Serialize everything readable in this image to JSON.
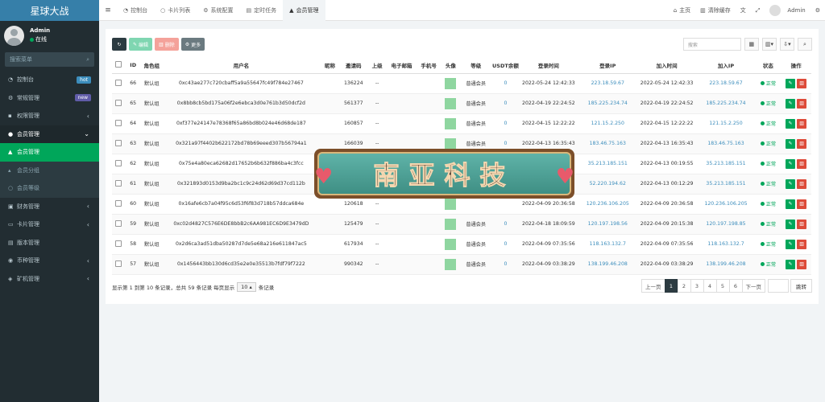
{
  "app": {
    "title": "星球大战"
  },
  "user": {
    "name": "Admin",
    "status": "在线"
  },
  "sidebar": {
    "search_placeholder": "搜索菜单",
    "items": [
      {
        "label": "控制台",
        "icon": "dashboard-icon",
        "badge": "hot",
        "badge_color": "#3c8dbc"
      },
      {
        "label": "常规管理",
        "icon": "cog-icon",
        "badge": "new",
        "badge_color": "#605ca8"
      },
      {
        "label": "权限管理",
        "icon": "group-icon"
      },
      {
        "label": "会员管理",
        "icon": "user-circle-icon"
      },
      {
        "label": "会员管理",
        "icon": "user-icon"
      },
      {
        "label": "会员分组",
        "icon": "users-icon"
      },
      {
        "label": "会员等级",
        "icon": "circle-icon"
      },
      {
        "label": "财务管理",
        "icon": "money-icon"
      },
      {
        "label": "卡片管理",
        "icon": "card-icon"
      },
      {
        "label": "版本管理",
        "icon": "book-icon"
      },
      {
        "label": "币种管理",
        "icon": "coin-icon"
      },
      {
        "label": "矿机管理",
        "icon": "server-icon"
      }
    ]
  },
  "topbar": {
    "tabs": [
      "控制台",
      "卡片列表",
      "系统配置",
      "定时任务",
      "会员管理"
    ],
    "home": "主页",
    "clear_cache": "清除缓存",
    "user": "Admin"
  },
  "toolbar": {
    "edit": "编辑",
    "delete": "删除",
    "more": "更多",
    "search_placeholder": "搜索"
  },
  "table": {
    "headers": [
      "ID",
      "角色组",
      "用户名",
      "昵称",
      "邀请码",
      "上级",
      "电子邮箱",
      "手机号",
      "头像",
      "等级",
      "USDT余额",
      "登录时间",
      "登录IP",
      "加入时间",
      "加入IP",
      "状态",
      "操作"
    ],
    "rows": [
      {
        "id": "66",
        "group": "默认组",
        "username": "0xc43ae277c720cbaff5a9a55647fc49f784e27467",
        "code": "136224",
        "parent": "--",
        "level": "普通会员",
        "usdt": "0",
        "login_time": "2022-05-24 12:42:33",
        "login_ip": "223.18.59.67",
        "join_time": "2022-05-24 12:42:33",
        "join_ip": "223.18.59.67",
        "status": "正常"
      },
      {
        "id": "65",
        "group": "默认组",
        "username": "0x8bb8cb5bd175a06f2e6ebca3d0e761b3d50dcf2d",
        "code": "561377",
        "parent": "--",
        "level": "普通会员",
        "usdt": "0",
        "login_time": "2022-04-19 22:24:52",
        "login_ip": "185.225.234.74",
        "join_time": "2022-04-19 22:24:52",
        "join_ip": "185.225.234.74",
        "status": "正常"
      },
      {
        "id": "64",
        "group": "默认组",
        "username": "0xf377e24147e78368f65a86bd8b024e46d68de187",
        "code": "160857",
        "parent": "--",
        "level": "普通会员",
        "usdt": "0",
        "login_time": "2022-04-15 12:22:22",
        "login_ip": "121.15.2.250",
        "join_time": "2022-04-15 12:22:22",
        "join_ip": "121.15.2.250",
        "status": "正常"
      },
      {
        "id": "63",
        "group": "默认组",
        "username": "0x321a97f4402b622172bd78b69eeed307b56794a1",
        "code": "166039",
        "parent": "--",
        "level": "普通会员",
        "usdt": "0",
        "login_time": "2022-04-13 16:35:43",
        "login_ip": "183.46.75.163",
        "join_time": "2022-04-13 16:35:43",
        "join_ip": "183.46.75.163",
        "status": "正常"
      },
      {
        "id": "62",
        "group": "默认组",
        "username": "0x75e4a80eca62682d17652b6b632f886ba4c3fcc",
        "code": "",
        "parent": "",
        "level": "",
        "usdt": "",
        "login_time": "4-13 00:19:55",
        "login_ip": "35.213.185.151",
        "join_time": "2022-04-13 00:19:55",
        "join_ip": "35.213.185.151",
        "status": "正常"
      },
      {
        "id": "61",
        "group": "默认组",
        "username": "0x321893d0153d9ba2bc1c9c24d62d69d37cd112b",
        "code": "",
        "parent": "",
        "level": "",
        "usdt": "",
        "login_time": "4-18 18:17:18",
        "login_ip": "52.220.194.62",
        "join_time": "2022-04-13 00:12:29",
        "join_ip": "35.213.185.151",
        "status": "正常"
      },
      {
        "id": "60",
        "group": "默认组",
        "username": "0x16afe6cb7a04f95c6d53f6f83d718b57ddca684e",
        "code": "120618",
        "parent": "--",
        "level": "",
        "usdt": "",
        "login_time": "2022-04-09 20:36:58",
        "login_ip": "120.236.106.205",
        "join_time": "2022-04-09 20:36:58",
        "join_ip": "120.236.106.205",
        "status": "正常"
      },
      {
        "id": "59",
        "group": "默认组",
        "username": "0xc02d4827C576E6DE8bbB2c6AA981EC6D9E3479dD",
        "code": "125479",
        "parent": "--",
        "level": "普通会员",
        "usdt": "0",
        "login_time": "2022-04-18 18:09:59",
        "login_ip": "120.197.198.56",
        "join_time": "2022-04-09 20:15:38",
        "join_ip": "120.197.198.85",
        "status": "正常"
      },
      {
        "id": "58",
        "group": "默认组",
        "username": "0x2d6ca3ad51dba50287d7de5e68a216e611847ac5",
        "code": "617934",
        "parent": "--",
        "level": "普通会员",
        "usdt": "0",
        "login_time": "2022-04-09 07:35:56",
        "login_ip": "118.163.132.7",
        "join_time": "2022-04-09 07:35:56",
        "join_ip": "118.163.132.7",
        "status": "正常"
      },
      {
        "id": "57",
        "group": "默认组",
        "username": "0x1456443bb130d6cd35e2e0e35513b7fdf79f7222",
        "code": "990342",
        "parent": "--",
        "level": "普通会员",
        "usdt": "0",
        "login_time": "2022-04-09 03:38:29",
        "login_ip": "138.199.46.208",
        "join_time": "2022-04-09 03:38:29",
        "join_ip": "138.199.46.208",
        "status": "正常"
      }
    ]
  },
  "footer": {
    "info_before": "显示第 1 到第 10 条记录，总共 59 条记录 每页显示",
    "per_page": "10",
    "info_after": "条记录"
  },
  "pager": {
    "prev": "上一页",
    "pages": [
      "1",
      "2",
      "3",
      "4",
      "5",
      "6"
    ],
    "next": "下一页",
    "jump": "跳转"
  },
  "watermark": {
    "text": "南亚科技"
  }
}
